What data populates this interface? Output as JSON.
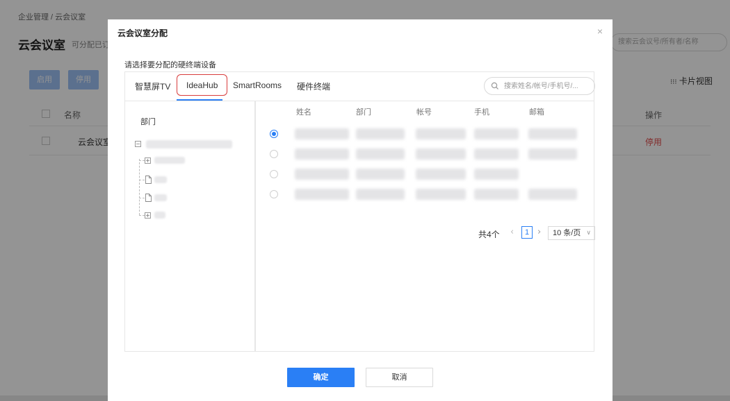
{
  "background": {
    "breadcrumb": "企业管理 / 云会议室",
    "title": "云会议室",
    "subtitle": "可分配已订",
    "search_placeholder": "搜索云会议号/所有者/名称",
    "buttons": {
      "enable": "启用",
      "disable": "停用"
    },
    "card_view_label": "卡片视图",
    "table": {
      "col_name": "名称",
      "col_op": "操作",
      "row_name": "云会议室",
      "row_op": "停用"
    }
  },
  "modal": {
    "title": "云会议室分配",
    "close": "×",
    "instruction": "请选择要分配的硬终端设备",
    "tabs": [
      {
        "label": "智慧屏TV"
      },
      {
        "label": "IdeaHub",
        "active": true,
        "highlighted": true
      },
      {
        "label": "SmartRooms"
      },
      {
        "label": "硬件终端"
      }
    ],
    "search": {
      "placeholder": "搜索姓名/帐号/手机号/..."
    },
    "dept_label": "部门",
    "columns": [
      "姓名",
      "部门",
      "帐号",
      "手机",
      "邮箱"
    ],
    "rows_selected_index": 0,
    "pagination": {
      "total": "共4个",
      "current_page": "1",
      "page_size": "10 条/页"
    },
    "confirm_label": "确定",
    "cancel_label": "取消"
  },
  "colors": {
    "primary": "#2a7ff5",
    "highlight_box": "#d83b3b",
    "danger_text": "#e04a4a"
  }
}
